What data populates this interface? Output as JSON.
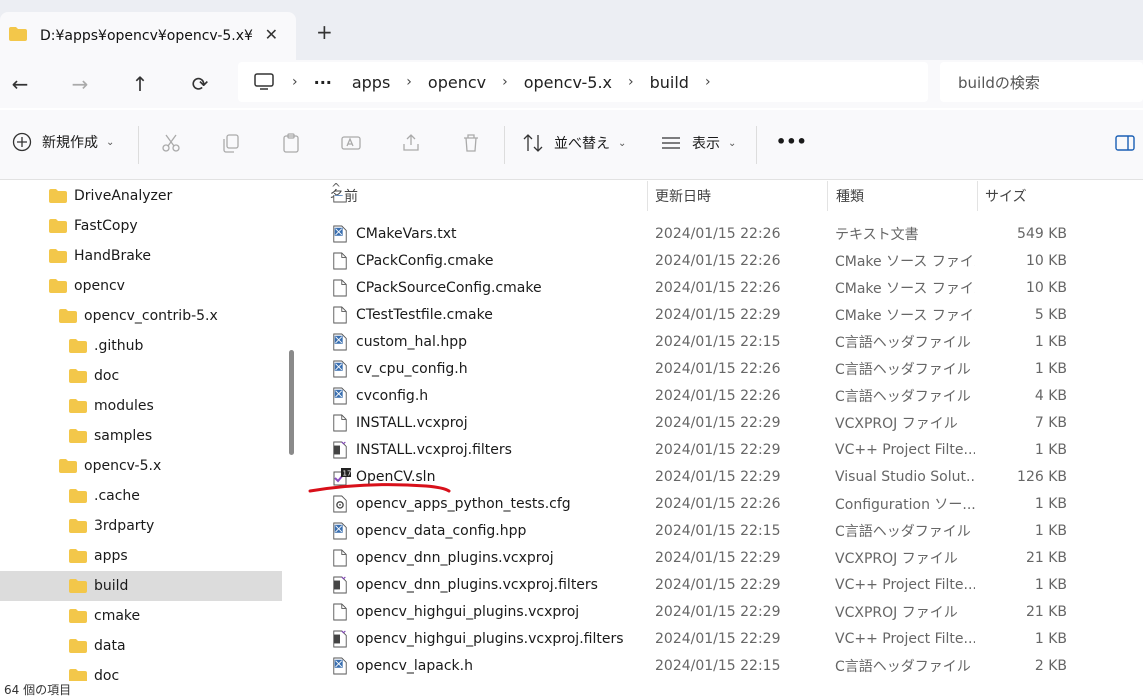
{
  "window": {
    "tab_title": "D:¥apps¥opencv¥opencv-5.x¥",
    "close_glyph": "✕",
    "newtab_glyph": "+"
  },
  "nav": {
    "back": "←",
    "forward": "→",
    "up": "↑",
    "refresh": "⟳",
    "more_glyph": "···",
    "breadcrumb": [
      "apps",
      "opencv",
      "opencv-5.x",
      "build"
    ],
    "search_placeholder": "buildの検索"
  },
  "toolbar": {
    "new_label": "新規作成",
    "sort_label": "並べ替え",
    "view_label": "表示",
    "more_label": "•••"
  },
  "sidebar": {
    "items": [
      {
        "label": "DriveAnalyzer",
        "indent": 0
      },
      {
        "label": "FastCopy",
        "indent": 0
      },
      {
        "label": "HandBrake",
        "indent": 0
      },
      {
        "label": "opencv",
        "indent": 0
      },
      {
        "label": "opencv_contrib-5.x",
        "indent": 1
      },
      {
        "label": ".github",
        "indent": 2
      },
      {
        "label": "doc",
        "indent": 2
      },
      {
        "label": "modules",
        "indent": 2
      },
      {
        "label": "samples",
        "indent": 2
      },
      {
        "label": "opencv-5.x",
        "indent": 1
      },
      {
        "label": ".cache",
        "indent": 2
      },
      {
        "label": "3rdparty",
        "indent": 2
      },
      {
        "label": "apps",
        "indent": 2
      },
      {
        "label": "build",
        "indent": 2,
        "selected": true
      },
      {
        "label": "cmake",
        "indent": 2
      },
      {
        "label": "data",
        "indent": 2
      },
      {
        "label": "doc",
        "indent": 2
      }
    ]
  },
  "columns": {
    "name": "名前",
    "date": "更新日時",
    "type": "種類",
    "size": "サイズ",
    "sort_glyph": "^"
  },
  "files": [
    {
      "name": "CMakeVars.txt",
      "date": "2024/01/15 22:26",
      "type": "テキスト文書",
      "size": "549 KB",
      "icon": "code-file-icon"
    },
    {
      "name": "CPackConfig.cmake",
      "date": "2024/01/15 22:26",
      "type": "CMake ソース ファイル",
      "size": "10 KB",
      "icon": "file-icon"
    },
    {
      "name": "CPackSourceConfig.cmake",
      "date": "2024/01/15 22:26",
      "type": "CMake ソース ファイル",
      "size": "10 KB",
      "icon": "file-icon"
    },
    {
      "name": "CTestTestfile.cmake",
      "date": "2024/01/15 22:29",
      "type": "CMake ソース ファイル",
      "size": "5 KB",
      "icon": "file-icon"
    },
    {
      "name": "custom_hal.hpp",
      "date": "2024/01/15 22:15",
      "type": "C言語ヘッダファイル",
      "size": "1 KB",
      "icon": "code-file-icon"
    },
    {
      "name": "cv_cpu_config.h",
      "date": "2024/01/15 22:26",
      "type": "C言語ヘッダファイル",
      "size": "1 KB",
      "icon": "code-file-icon"
    },
    {
      "name": "cvconfig.h",
      "date": "2024/01/15 22:26",
      "type": "C言語ヘッダファイル",
      "size": "4 KB",
      "icon": "code-file-icon"
    },
    {
      "name": "INSTALL.vcxproj",
      "date": "2024/01/15 22:29",
      "type": "VCXPROJ ファイル",
      "size": "7 KB",
      "icon": "file-icon"
    },
    {
      "name": "INSTALL.vcxproj.filters",
      "date": "2024/01/15 22:29",
      "type": "VC++ Project Filte...",
      "size": "1 KB",
      "icon": "filters-file-icon"
    },
    {
      "name": "OpenCV.sln",
      "date": "2024/01/15 22:29",
      "type": "Visual Studio Solut...",
      "size": "126 KB",
      "icon": "visual-studio-solution-icon"
    },
    {
      "name": "opencv_apps_python_tests.cfg",
      "date": "2024/01/15 22:26",
      "type": "Configuration ソー...",
      "size": "1 KB",
      "icon": "config-file-icon"
    },
    {
      "name": "opencv_data_config.hpp",
      "date": "2024/01/15 22:15",
      "type": "C言語ヘッダファイル",
      "size": "1 KB",
      "icon": "code-file-icon"
    },
    {
      "name": "opencv_dnn_plugins.vcxproj",
      "date": "2024/01/15 22:29",
      "type": "VCXPROJ ファイル",
      "size": "21 KB",
      "icon": "file-icon"
    },
    {
      "name": "opencv_dnn_plugins.vcxproj.filters",
      "date": "2024/01/15 22:29",
      "type": "VC++ Project Filte...",
      "size": "1 KB",
      "icon": "filters-file-icon"
    },
    {
      "name": "opencv_highgui_plugins.vcxproj",
      "date": "2024/01/15 22:29",
      "type": "VCXPROJ ファイル",
      "size": "21 KB",
      "icon": "file-icon"
    },
    {
      "name": "opencv_highgui_plugins.vcxproj.filters",
      "date": "2024/01/15 22:29",
      "type": "VC++ Project Filte...",
      "size": "1 KB",
      "icon": "filters-file-icon"
    },
    {
      "name": "opencv_lapack.h",
      "date": "2024/01/15 22:15",
      "type": "C言語ヘッダファイル",
      "size": "2 KB",
      "icon": "code-file-icon"
    }
  ],
  "status": {
    "item_count": "64 個の項目"
  },
  "colors": {
    "folder": "#f3c74a",
    "annotation": "#d8101a",
    "selected_bg": "#dcdcdc"
  }
}
